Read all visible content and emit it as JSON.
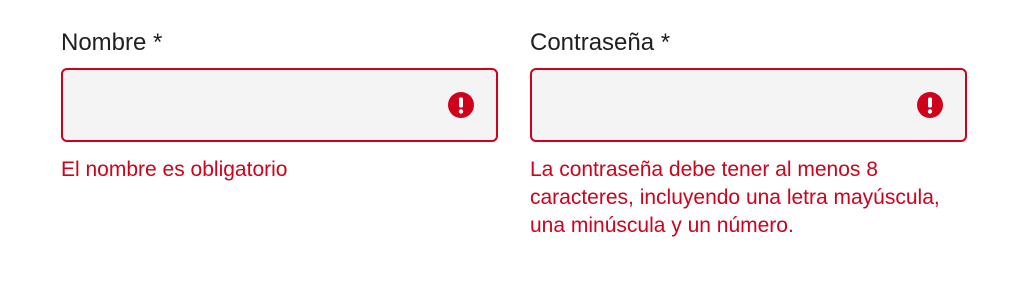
{
  "form": {
    "name_field": {
      "label": "Nombre *",
      "value": "",
      "error": "El nombre es obligatorio",
      "icon": "error-icon"
    },
    "password_field": {
      "label": "Contraseña *",
      "value": "",
      "error": "La contraseña debe tener al menos 8 caracteres, incluyendo una letra mayúscula, una minúscula y un número.",
      "icon": "error-icon"
    },
    "colors": {
      "error": "#d0011b",
      "input_background": "#f4f4f4",
      "label": "#1f1f1f"
    }
  }
}
